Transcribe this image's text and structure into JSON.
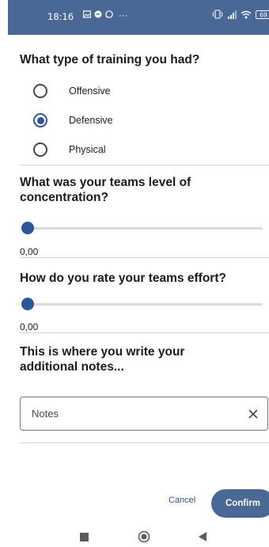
{
  "status_bar": {
    "time": "18:16",
    "more": "···",
    "battery": "69",
    "left_icons": [
      "gallery-icon",
      "messenger-icon",
      "whatsapp-icon"
    ],
    "right_icons": [
      "vibrate-icon",
      "signal-icon",
      "wifi-icon",
      "battery-icon"
    ]
  },
  "training": {
    "question": "What type of training you had?",
    "options": [
      {
        "label": "Offensive",
        "selected": false
      },
      {
        "label": "Defensive",
        "selected": true
      },
      {
        "label": "Physical",
        "selected": false
      }
    ]
  },
  "concentration": {
    "question": "What was your teams level of concentration?",
    "value": 0,
    "value_label": "0,00"
  },
  "effort": {
    "question": "How do you rate your teams effort?",
    "value": 0,
    "value_label": "0,00"
  },
  "notes": {
    "question": "This is where you write your additional notes...",
    "placeholder": "Notes",
    "value": ""
  },
  "actions": {
    "cancel_label": "Cancel",
    "confirm_label": "Confirm"
  },
  "nav": {
    "buttons": [
      "recents-icon",
      "home-icon",
      "back-icon"
    ]
  },
  "colors": {
    "primary": "#2e5596",
    "header": "#4a6896",
    "divider": "#d5d5d8"
  }
}
